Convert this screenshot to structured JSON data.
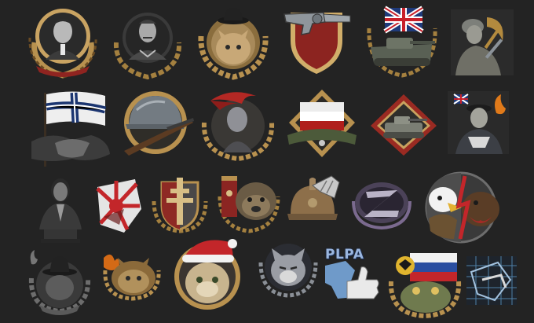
{
  "screen": {
    "background": "#232323",
    "type": "achievement icon collection"
  },
  "palette": {
    "gold": "#b8914f",
    "gold_light": "#e3c489",
    "gold_dark": "#5e4420",
    "red": "#8f2420",
    "steel": "#8b9299",
    "dark": "#1a1a1a"
  },
  "achievements": [
    {
      "name": "portrait-medal-icon"
    },
    {
      "name": "general-portrait-medal-icon"
    },
    {
      "name": "bowler-hat-cat-medal-icon"
    },
    {
      "name": "revolver-shield-medal-icon"
    },
    {
      "name": "union-jack-tank-medal-icon"
    },
    {
      "name": "hammer-sickle-soldier-icon"
    },
    {
      "name": "handshake-flag-icon"
    },
    {
      "name": "helmet-rifle-medal-icon"
    },
    {
      "name": "red-cap-bust-medal-icon"
    },
    {
      "name": "german-flag-medal-icon"
    },
    {
      "name": "tank-diamond-medal-icon"
    },
    {
      "name": "sailor-burning-flag-icon"
    },
    {
      "name": "statesman-bust-icon"
    },
    {
      "name": "rising-sun-map-icon"
    },
    {
      "name": "lorraine-cross-shield-icon"
    },
    {
      "name": "banner-bulldog-medal-icon"
    },
    {
      "name": "adrian-helmet-gauntlet-icon"
    },
    {
      "name": "z-emblem-medal-icon"
    },
    {
      "name": "eagle-bear-split-icon"
    },
    {
      "name": "smoking-hat-wreath-icon"
    },
    {
      "name": "burning-cat-medal-icon"
    },
    {
      "name": "santa-hat-cat-medal-icon"
    },
    {
      "name": "grumpy-cat-wreath-icon"
    },
    {
      "name": "plpa-thumbs-up-map-icon"
    },
    {
      "name": "eagle-flag-toad-medal-icon"
    },
    {
      "name": "blueprint-grid-map-icon"
    }
  ],
  "labels": {
    "plpa": "PLPA"
  }
}
